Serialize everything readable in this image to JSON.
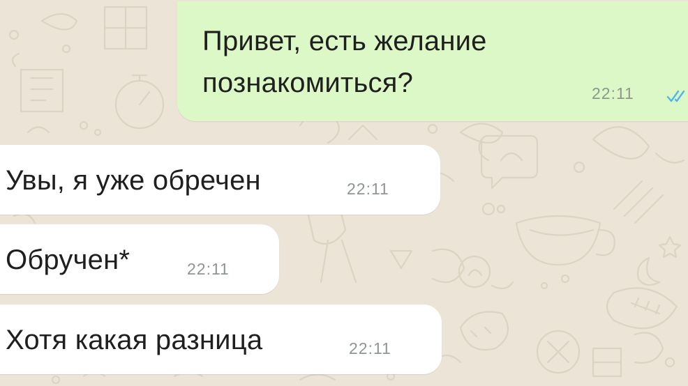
{
  "conversation": {
    "messages": [
      {
        "direction": "outgoing",
        "lines": [
          "Привет, есть желание",
          "познакомиться?"
        ],
        "time": "22:11",
        "status_icon": "double-check-icon",
        "status_color": "#4fb6ec"
      },
      {
        "direction": "incoming",
        "text": "Увы, я уже обречен",
        "time": "22:11"
      },
      {
        "direction": "incoming",
        "text": "Обручен*",
        "time": "22:11"
      },
      {
        "direction": "incoming",
        "text": "Хотя какая разница",
        "time": "22:11"
      }
    ]
  },
  "colors": {
    "wallpaper": "#ece4d6",
    "outgoing_bubble": "#dcf8c6",
    "incoming_bubble": "#ffffff",
    "time_text": "#8e9690",
    "read_ticks": "#4fb6ec"
  }
}
